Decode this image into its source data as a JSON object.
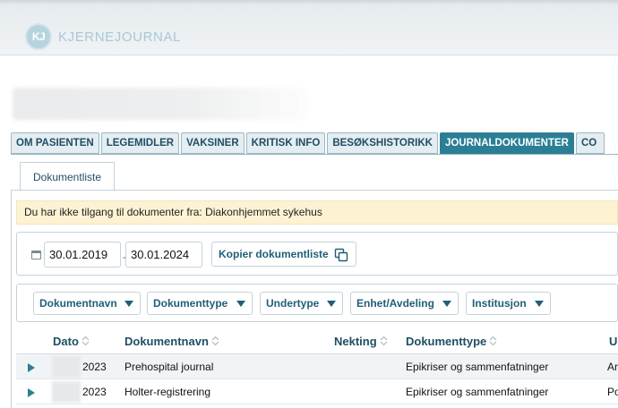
{
  "app": {
    "logo_initials": "KJ",
    "logo_name": "KJERNEJOURNAL"
  },
  "tabs": [
    {
      "label": "OM PASIENTEN",
      "active": false
    },
    {
      "label": "LEGEMIDLER",
      "active": false
    },
    {
      "label": "VAKSINER",
      "active": false
    },
    {
      "label": "KRITISK INFO",
      "active": false
    },
    {
      "label": "BESØKSHISTORIKK",
      "active": false
    },
    {
      "label": "JOURNALDOKUMENTER",
      "active": true
    },
    {
      "label": "CO",
      "active": false
    }
  ],
  "subtab": {
    "label": "Dokumentliste"
  },
  "warning": {
    "text": "Du har ikke tilgang til dokumenter fra: Diakonhjemmet sykehus"
  },
  "date_filter": {
    "from": "30.01.2019",
    "separator": "-",
    "to": "30.01.2024",
    "copy_label": "Kopier dokumentliste"
  },
  "filters": [
    {
      "label": "Dokumentnavn"
    },
    {
      "label": "Dokumenttype"
    },
    {
      "label": "Undertype"
    },
    {
      "label": "Enhet/Avdeling"
    },
    {
      "label": "Institusjon"
    }
  ],
  "table": {
    "columns": [
      "Dato",
      "Dokumentnavn",
      "Nekting",
      "Dokumenttype",
      "U"
    ],
    "rows": [
      {
        "dato": "2023",
        "dokumentnavn": "Prehospital journal",
        "nekting": "",
        "dokumenttype": "Epikriser og sammenfatninger",
        "u": "Ar"
      },
      {
        "dato": "2023",
        "dokumentnavn": "Holter-registrering",
        "nekting": "",
        "dokumenttype": "Epikriser og sammenfatninger",
        "u": "Po"
      }
    ]
  },
  "colors": {
    "accent": "#2b7f95",
    "tab_bg": "#e4edf1",
    "warning_bg": "#fdf3d3",
    "text_link": "#1f5f78"
  }
}
